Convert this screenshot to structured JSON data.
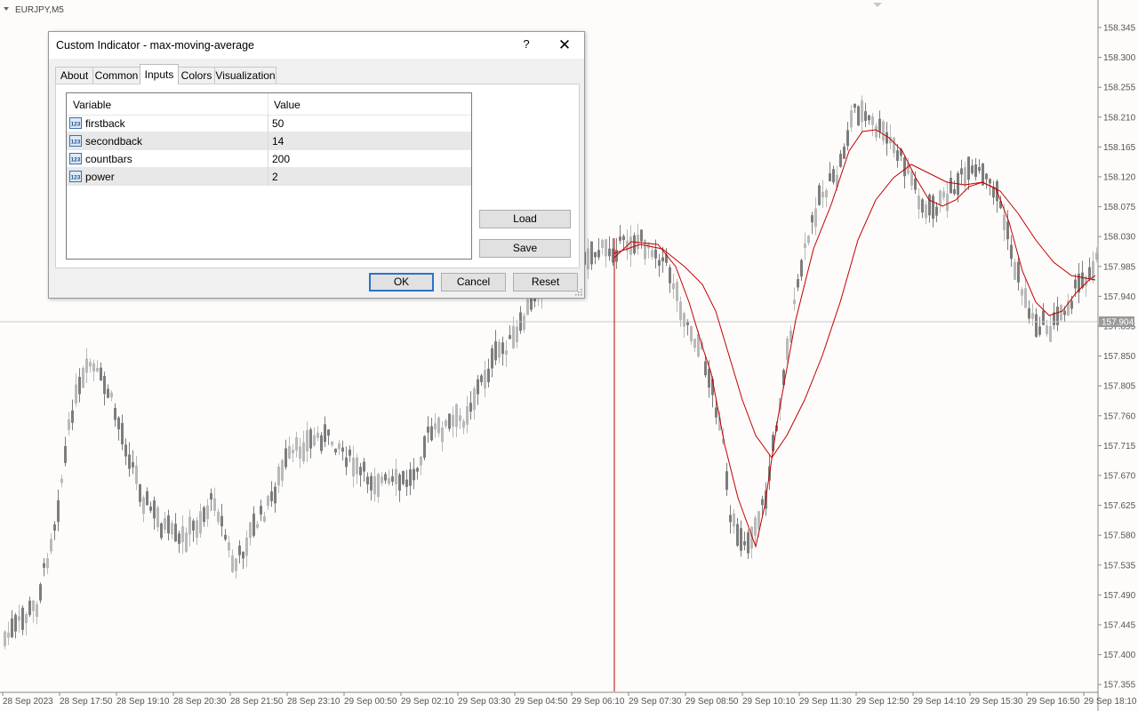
{
  "chart": {
    "symbol_label": "EURJPY,M5",
    "price_labels": [
      "158.345",
      "158.300",
      "158.255",
      "158.210",
      "158.165",
      "158.120",
      "158.075",
      "158.030",
      "157.985",
      "157.940",
      "157.895",
      "157.850",
      "157.805",
      "157.760",
      "157.715",
      "157.670",
      "157.625",
      "157.580",
      "157.535",
      "157.490",
      "157.445",
      "157.400",
      "157.355"
    ],
    "current_price": "157.904",
    "time_labels": [
      "28 Sep 2023",
      "28 Sep 17:50",
      "28 Sep 19:10",
      "28 Sep 20:30",
      "28 Sep 21:50",
      "28 Sep 23:10",
      "29 Sep 00:50",
      "29 Sep 02:10",
      "29 Sep 03:30",
      "29 Sep 04:50",
      "29 Sep 06:10",
      "29 Sep 07:30",
      "29 Sep 08:50",
      "29 Sep 10:10",
      "29 Sep 11:30",
      "29 Sep 12:50",
      "29 Sep 14:10",
      "29 Sep 15:30",
      "29 Sep 16:50",
      "29 Sep 18:10"
    ],
    "colors": {
      "background": "#fdfcfa",
      "candle": "#8f8f8f",
      "indicator": "#c00000",
      "grid_line": "#c8c8c8",
      "price_badge": "#9a9a9a"
    }
  },
  "dialog": {
    "title": "Custom Indicator - max-moving-average",
    "help_label": "?",
    "close_label": "✕",
    "tabs": [
      {
        "label": "About"
      },
      {
        "label": "Common"
      },
      {
        "label": "Inputs",
        "active": true
      },
      {
        "label": "Colors"
      },
      {
        "label": "Visualization"
      }
    ],
    "grid": {
      "headers": {
        "variable": "Variable",
        "value": "Value"
      },
      "rows": [
        {
          "name": "firstback",
          "value": "50",
          "icon": "integer-icon"
        },
        {
          "name": "secondback",
          "value": "14",
          "icon": "integer-icon"
        },
        {
          "name": "countbars",
          "value": "200",
          "icon": "integer-icon"
        },
        {
          "name": "power",
          "value": "2",
          "icon": "integer-icon"
        }
      ]
    },
    "buttons": {
      "load": "Load",
      "save": "Save",
      "ok": "OK",
      "cancel": "Cancel",
      "reset": "Reset"
    }
  }
}
